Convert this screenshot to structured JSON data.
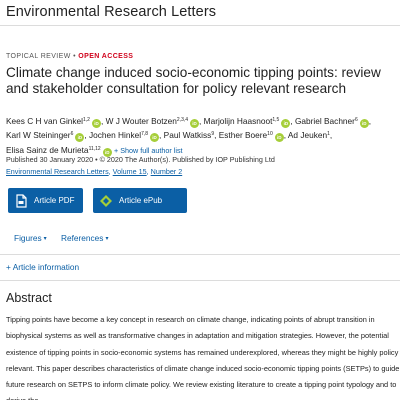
{
  "header": {
    "journal_name": "Environmental Research Letters"
  },
  "article": {
    "type_label": "TOPICAL REVIEW",
    "separator": " • ",
    "access_label": "OPEN ACCESS",
    "title": "Climate change induced socio-economic tipping points: review and stakeholder consultation for policy relevant research",
    "authors": [
      {
        "name": "Kees C H van Ginkel",
        "sup": "1,2",
        "orcid": true
      },
      {
        "name": "W J Wouter Botzen",
        "sup": "2,3,4",
        "orcid": true
      },
      {
        "name": "Marjolijn Haasnoot",
        "sup": "1,5",
        "orcid": true
      },
      {
        "name": "Gabriel Bachner",
        "sup": "6",
        "orcid": true
      },
      {
        "name": "Karl W Steininger",
        "sup": "6",
        "orcid": true
      },
      {
        "name": "Jochen Hinkel",
        "sup": "7,8",
        "orcid": true
      },
      {
        "name": "Paul Watkiss",
        "sup": "9",
        "orcid": false
      },
      {
        "name": "Esther Boere",
        "sup": "10",
        "orcid": true
      },
      {
        "name": "Ad Jeuken",
        "sup": "1",
        "orcid": false
      },
      {
        "name": "Elisa Sainz de Murieta",
        "sup": "11,12",
        "orcid": true
      }
    ],
    "show_full_author_list": "+ Show full author list",
    "published_line": "Published 30 January 2020 • © 2020 The Author(s). Published by IOP Publishing Ltd",
    "citation": {
      "journal": "Environmental Research Letters",
      "volume": "Volume 15",
      "number": "Number 2",
      "sep": ", "
    }
  },
  "actions": {
    "pdf_label": "Article PDF",
    "epub_label": "Article ePub"
  },
  "menus": {
    "figures_label": "Figures",
    "references_label": "References",
    "caret": "▾"
  },
  "article_information": "+ Article information",
  "abstract": {
    "heading": "Abstract",
    "text": "Tipping points have become a key concept in research on climate change, indicating points of abrupt transition in biophysical systems as well as transformative changes in adaptation and mitigation strategies. However, the potential existence of tipping points in socio-economic systems has remained underexplored, whereas they might be highly policy relevant. This paper describes characteristics of climate change induced socio-economic tipping points (SETPs) to guide future research on SETPS to inform climate policy. We review existing literature to create a tipping point typology and to derive the"
  },
  "icons": {
    "orcid": "orcid-icon",
    "pdf": "pdf-file-icon",
    "epub": "epub-icon"
  },
  "colors": {
    "link": "#0b5fa5",
    "button": "#0b5fa5",
    "open_access": "#d0021b",
    "orcid": "#a6ce39"
  }
}
